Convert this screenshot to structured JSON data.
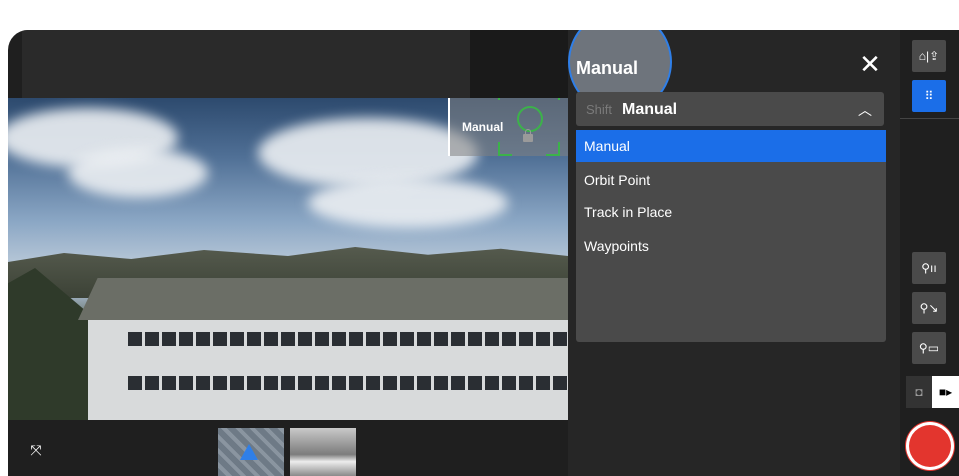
{
  "camera_view": {
    "mode_tag": "Manual"
  },
  "panel": {
    "title": "Manual",
    "close_icon": "close-icon",
    "select": {
      "prefix": "Shift",
      "value": "Manual"
    },
    "options": [
      {
        "label": "Manual",
        "selected": true
      },
      {
        "label": "Orbit Point",
        "selected": false
      },
      {
        "label": "Track in Place",
        "selected": false
      },
      {
        "label": "Waypoints",
        "selected": false
      }
    ]
  },
  "rail": {
    "home_label": "⌂|⇪",
    "grid_label": "⠿",
    "btn1_label": "⚲ıı",
    "btn2_label": "⚲↘",
    "btn3_label": "⚲▭"
  },
  "colors": {
    "accent": "#1b6ee8",
    "record": "#e3352e",
    "reticle": "#3cb24a"
  }
}
